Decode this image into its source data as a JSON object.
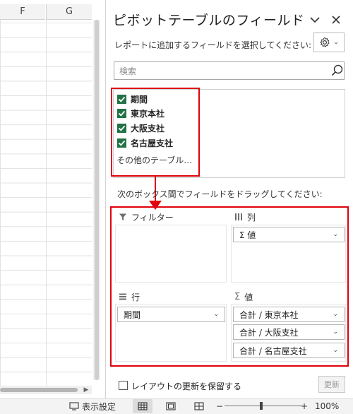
{
  "sheet": {
    "columns": [
      "F",
      "G"
    ]
  },
  "panel": {
    "title": "ピボットテーブルのフィールド",
    "dropdown_icon": "chevron-down",
    "close_icon": "close",
    "subtitle": "レポートに追加するフィールドを選択してください:",
    "settings_icon": "gear",
    "search": {
      "placeholder": "検索",
      "icon": "search"
    },
    "fields": [
      {
        "label": "期間",
        "checked": true
      },
      {
        "label": "東京本社",
        "checked": true
      },
      {
        "label": "大阪支社",
        "checked": true
      },
      {
        "label": "名古屋支社",
        "checked": true
      }
    ],
    "other_tables": "その他のテーブル…",
    "drag_label": "次のボックス間でフィールドをドラッグしてください:",
    "areas": {
      "filter": {
        "label": "フィルター",
        "icon": "filter",
        "items": []
      },
      "columns": {
        "label": "列",
        "icon": "columns",
        "items": [
          "Σ 値"
        ]
      },
      "rows": {
        "label": "行",
        "icon": "rows",
        "items": [
          "期間"
        ]
      },
      "values": {
        "label": "値",
        "icon": "sigma",
        "items": [
          "合計 / 東京本社",
          "合計 / 大阪支社",
          "合計 / 名古屋支社"
        ]
      }
    },
    "defer_label": "レイアウトの更新を保留する",
    "defer_checked": false,
    "update_button": "更新",
    "highlight_color": "#e0000b",
    "checkbox_color": "#217346"
  },
  "statusbar": {
    "display_settings": "表示設定",
    "zoom_minus": "−",
    "zoom_plus": "+",
    "zoom": "100%"
  }
}
